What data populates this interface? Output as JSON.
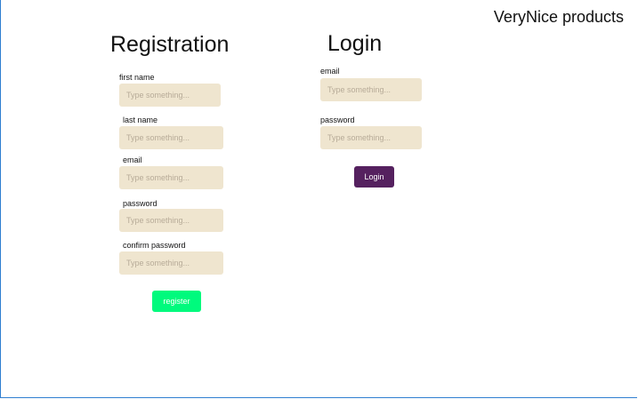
{
  "brand": "VeryNice products",
  "registration": {
    "title": "Registration",
    "fields": [
      {
        "label": "first name",
        "placeholder": "Type something..."
      },
      {
        "label": "last name",
        "placeholder": "Type something..."
      },
      {
        "label": "email",
        "placeholder": "Type something..."
      },
      {
        "label": "password",
        "placeholder": "Type something..."
      },
      {
        "label": "confirm password",
        "placeholder": "Type something..."
      }
    ],
    "submit_label": "register"
  },
  "login": {
    "title": "Login",
    "fields": [
      {
        "label": "email",
        "placeholder": "Type something..."
      },
      {
        "label": "password",
        "placeholder": "Type something..."
      }
    ],
    "submit_label": "Login"
  },
  "colors": {
    "input_bg": "#efe5cf",
    "register_button": "#00fa7d",
    "login_button": "#55215f",
    "frame_border": "#2f7fd1"
  }
}
